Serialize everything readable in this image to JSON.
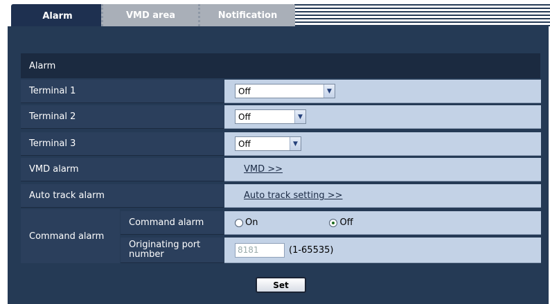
{
  "tabs": [
    {
      "label": "Alarm",
      "active": true
    },
    {
      "label": "VMD area",
      "active": false
    },
    {
      "label": "Notification",
      "active": false
    }
  ],
  "section_header": "Alarm",
  "rows": {
    "terminal1": {
      "label": "Terminal 1",
      "value": "Off"
    },
    "terminal2": {
      "label": "Terminal 2",
      "value": "Off"
    },
    "terminal3": {
      "label": "Terminal 3",
      "value": "Off"
    },
    "vmd_alarm": {
      "label": "VMD alarm",
      "link": "VMD >>"
    },
    "auto_track": {
      "label": "Auto track alarm",
      "link": "Auto track setting >>"
    }
  },
  "command_alarm": {
    "group_label": "Command alarm",
    "sub_label": "Command alarm",
    "option_on": "On",
    "option_off": "Off",
    "selected": "Off",
    "port_label": "Originating port number",
    "port_placeholder": "8181",
    "port_range": "(1-65535)"
  },
  "set_button": "Set",
  "colors": {
    "panel": "#253a55",
    "value_bg": "#c3d2e6",
    "active_tab": "#1e3050",
    "inactive_tab": "#a9afb8"
  }
}
